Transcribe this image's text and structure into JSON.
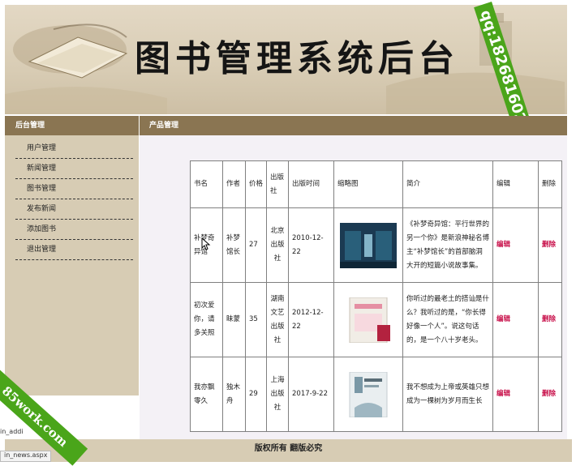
{
  "banner": {
    "title": "图书管理系统后台",
    "watermark_qq": "qq:1826816020"
  },
  "sidebar": {
    "heading": "后台管理",
    "items": [
      {
        "label": "用户管理"
      },
      {
        "label": "新闻管理"
      },
      {
        "label": "图书管理"
      },
      {
        "label": "发布新闻"
      },
      {
        "label": "添加图书"
      },
      {
        "label": "退出管理"
      }
    ]
  },
  "main": {
    "heading": "产品管理",
    "table": {
      "headers": {
        "name": "书名",
        "author": "作者",
        "price": "价格",
        "publisher": "出版社",
        "date": "出版时间",
        "thumb": "缩略图",
        "intro": "简介",
        "edit": "编辑",
        "delete": "删除"
      },
      "rows": [
        {
          "name": "补梦奇异馆",
          "author": "补梦馆长",
          "price": "27",
          "publisher": "北京出版社",
          "date": "2010-12-22",
          "intro": "《补梦奇异馆：平行世界的另一个你》是新浪神秘名博主“补梦馆长”的首部脑洞大开的短篇小说故事集。",
          "edit": "编辑",
          "delete": "删除",
          "cover_color": "#1b3a52"
        },
        {
          "name": "初次爱你，请多关照",
          "author": "昧蒙",
          "price": "35",
          "publisher": "湖南文艺出版社",
          "date": "2012-12-22",
          "intro": "你听过的最老土的搭讪是什么？我听过的是，“你长得好像一个人”。说这句话的，是一个八十岁老头。",
          "edit": "编辑",
          "delete": "删除",
          "cover_color": "#f1ede6"
        },
        {
          "name": "我亦飘零久",
          "author": "独木舟",
          "price": "29",
          "publisher": "上海出版社",
          "date": "2017-9-22",
          "intro": "我不想成为上帝或英雄只想成为一棵树为岁月而生长",
          "edit": "编辑",
          "delete": "删除",
          "cover_color": "#e9eef0"
        }
      ]
    }
  },
  "footer": {
    "copyright": "版权所有 翻版必究"
  },
  "statusbar": {
    "url_1": "in_addi",
    "url_2": "in_news.aspx"
  },
  "watermark_site": "85work.com"
}
